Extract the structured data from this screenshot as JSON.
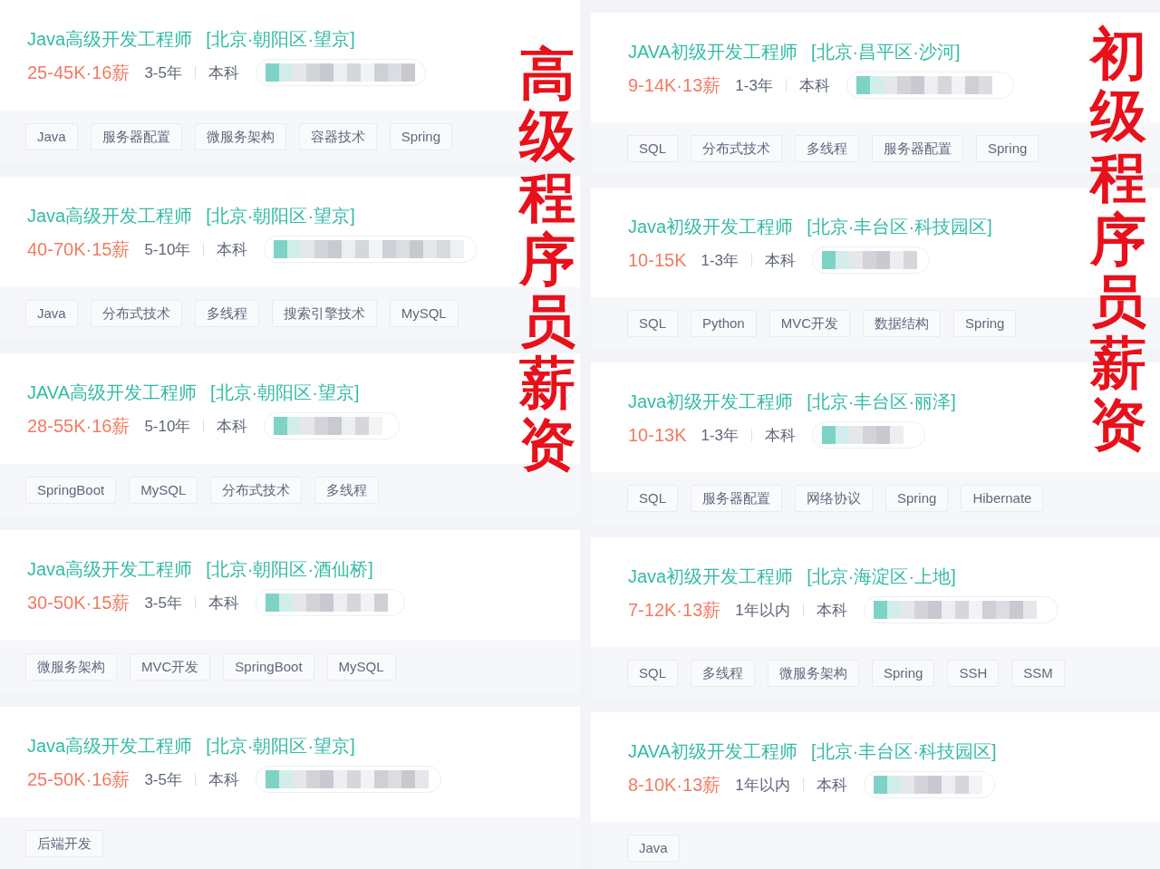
{
  "columns": [
    {
      "heading": "高级程序员薪资",
      "jobs": [
        {
          "title": "Java高级开发工程师",
          "location": "[北京·朝阳区·望京]",
          "salary": "25-45K·16薪",
          "experience": "3-5年",
          "degree": "本科",
          "tags": [
            "Java",
            "服务器配置",
            "微服务架构",
            "容器技术",
            "Spring"
          ]
        },
        {
          "title": "Java高级开发工程师",
          "location": "[北京·朝阳区·望京]",
          "salary": "40-70K·15薪",
          "experience": "5-10年",
          "degree": "本科",
          "tags": [
            "Java",
            "分布式技术",
            "多线程",
            "搜索引擎技术",
            "MySQL"
          ]
        },
        {
          "title": "JAVA高级开发工程师",
          "location": "[北京·朝阳区·望京]",
          "salary": "28-55K·16薪",
          "experience": "5-10年",
          "degree": "本科",
          "tags": [
            "SpringBoot",
            "MySQL",
            "分布式技术",
            "多线程"
          ]
        },
        {
          "title": "Java高级开发工程师",
          "location": "[北京·朝阳区·酒仙桥]",
          "salary": "30-50K·15薪",
          "experience": "3-5年",
          "degree": "本科",
          "tags": [
            "微服务架构",
            "MVC开发",
            "SpringBoot",
            "MySQL"
          ]
        },
        {
          "title": "Java高级开发工程师",
          "location": "[北京·朝阳区·望京]",
          "salary": "25-50K·16薪",
          "experience": "3-5年",
          "degree": "本科",
          "tags": [
            "后端开发"
          ]
        }
      ]
    },
    {
      "heading": "初级程序员薪资",
      "jobs": [
        {
          "title": "JAVA初级开发工程师",
          "location": "[北京·昌平区·沙河]",
          "salary": "9-14K·13薪",
          "experience": "1-3年",
          "degree": "本科",
          "tags": [
            "SQL",
            "分布式技术",
            "多线程",
            "服务器配置",
            "Spring"
          ]
        },
        {
          "title": "Java初级开发工程师",
          "location": "[北京·丰台区·科技园区]",
          "salary": "10-15K",
          "experience": "1-3年",
          "degree": "本科",
          "tags": [
            "SQL",
            "Python",
            "MVC开发",
            "数据结构",
            "Spring"
          ]
        },
        {
          "title": "Java初级开发工程师",
          "location": "[北京·丰台区·丽泽]",
          "salary": "10-13K",
          "experience": "1-3年",
          "degree": "本科",
          "tags": [
            "SQL",
            "服务器配置",
            "网络协议",
            "Spring",
            "Hibernate"
          ]
        },
        {
          "title": "Java初级开发工程师",
          "location": "[北京·海淀区·上地]",
          "salary": "7-12K·13薪",
          "experience": "1年以内",
          "degree": "本科",
          "tags": [
            "SQL",
            "多线程",
            "微服务架构",
            "Spring",
            "SSH",
            "SSM"
          ]
        },
        {
          "title": "JAVA初级开发工程师",
          "location": "[北京·丰台区·科技园区]",
          "salary": "8-10K·13薪",
          "experience": "1年以内",
          "degree": "本科",
          "tags": [
            "Java"
          ]
        }
      ]
    }
  ]
}
